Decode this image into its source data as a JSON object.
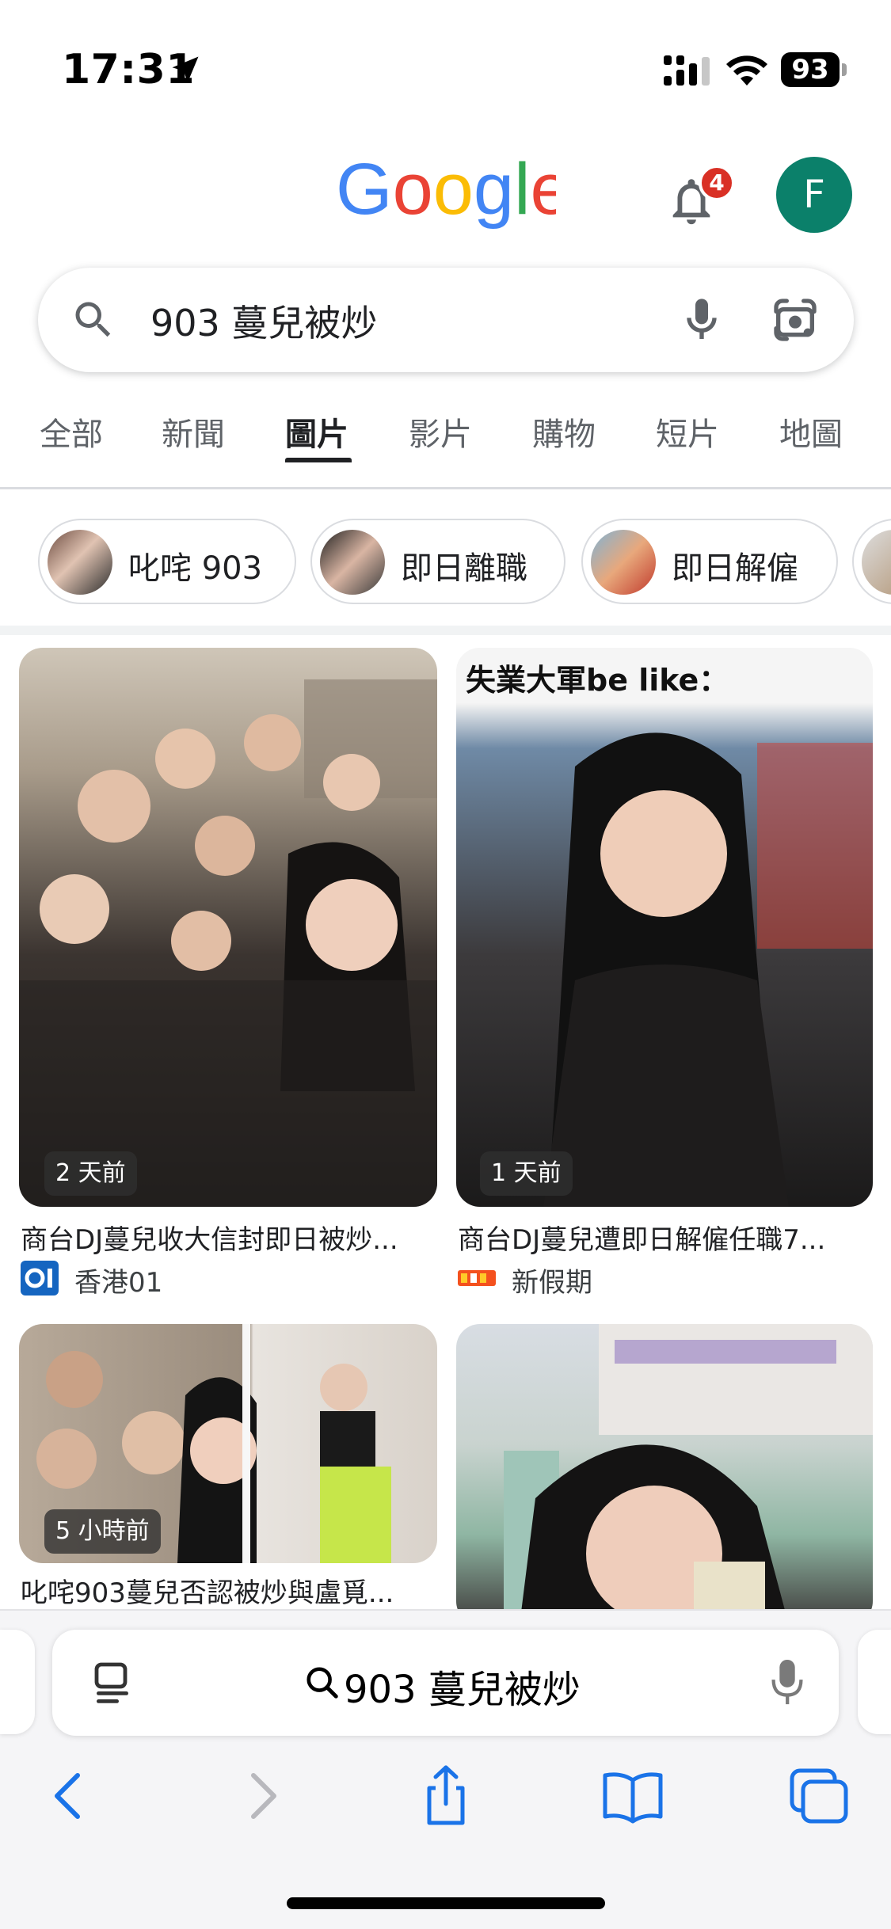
{
  "status_bar": {
    "time": "17:31",
    "battery": "93",
    "icons": [
      "location-arrow-icon",
      "signal-icon",
      "wifi-icon",
      "battery-icon"
    ]
  },
  "header": {
    "logo": "Google",
    "notification_count": "4",
    "avatar_initial": "F",
    "avatar_color": "#0b806a"
  },
  "search": {
    "query": "903 蔓兒被炒"
  },
  "tabs": [
    {
      "label": "全部"
    },
    {
      "label": "新聞"
    },
    {
      "label": "圖片"
    },
    {
      "label": "影片"
    },
    {
      "label": "購物"
    },
    {
      "label": "短片"
    },
    {
      "label": "地圖"
    }
  ],
  "active_tab": "圖片",
  "chips": [
    {
      "label": "叱咤 903"
    },
    {
      "label": "即日離職"
    },
    {
      "label": "即日解僱"
    }
  ],
  "results": [
    {
      "time": "2 天前",
      "title": "商台DJ蔓兒收大信封即日被炒...",
      "source": "香港01"
    },
    {
      "time": "1 天前",
      "title": "商台DJ蔓兒遭即日解僱任職7...",
      "source": "新假期",
      "overlay_text": "失業大軍be like："
    },
    {
      "time": "5 小時前",
      "title": "叱咤903蔓兒否認被炒與盧覓...",
      "source": ""
    },
    {
      "time": "",
      "title": "",
      "source": ""
    }
  ],
  "safari": {
    "address_text": "903 蔓兒被炒"
  },
  "colors": {
    "google_blue": "#4285F4",
    "google_red": "#EA4335",
    "google_yellow": "#FBBC05",
    "google_green": "#34A853",
    "safari_blue": "#1a73e8"
  }
}
